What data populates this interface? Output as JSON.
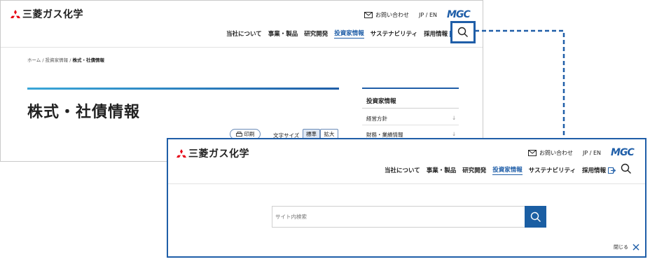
{
  "brand": {
    "name": "三菱ガス化学",
    "logo_text": "MGC"
  },
  "utility": {
    "contact": "お問い合わせ",
    "language": "JP / EN"
  },
  "nav": {
    "items": [
      "当社について",
      "事業・製品",
      "研究開発",
      "投資家情報",
      "サステナビリティ",
      "採用情報"
    ],
    "active_index": 3
  },
  "breadcrumb": {
    "home": "ホーム",
    "parent": "投資家情報",
    "current": "株式・社債情報",
    "separator": "/"
  },
  "page": {
    "title": "株式・社債情報"
  },
  "tools": {
    "print": "印刷",
    "font_size_label": "文字サイズ",
    "font_standard": "標準",
    "font_large": "拡大"
  },
  "sidebar": {
    "title": "投資家情報",
    "items": [
      "経営方針",
      "財務・業績情報"
    ]
  },
  "search": {
    "placeholder": "サイト内検索",
    "close_label": "閉じる"
  },
  "colors": {
    "accent": "#1f5ea8",
    "search_button": "#1a5ea3",
    "logo_red": "#e60012",
    "cyan_rule": "#3aa7d8"
  }
}
